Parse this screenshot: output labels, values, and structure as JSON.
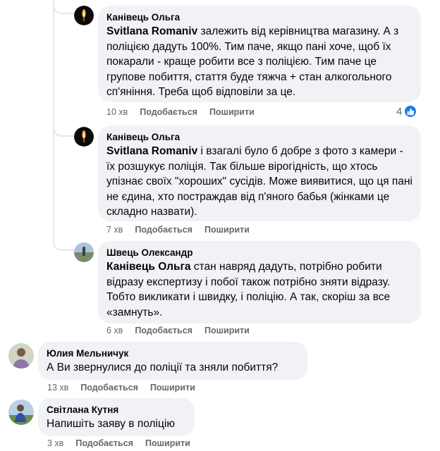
{
  "comments": [
    {
      "author": "Канівець Ольга",
      "mention": "Svitlana Romaniv",
      "text": " залежить від керівництва магазину. А з поліцією дадуть 100%. Тим паче, якщо пані хоче, щоб їх покарали - краще робити все з поліцією. Тим паче це групове побиття, стаття буде тяжча + стан алкогольного сп'яніння. Треба щоб відповіли за це.",
      "time": "10 хв",
      "like_label": "Подобається",
      "share_label": "Поширити",
      "reaction_count": "4",
      "reaction_icon": "like-icon"
    },
    {
      "author": "Канівець Ольга",
      "mention": "Svitlana Romaniv",
      "text": " і взагалі було б добре з фото з камери - їх розшукує поліція. Так більше вірогідність, що хтось упізнає своїх \"хороших\" сусідів. Може виявитися, що ця пані не єдина, хто постраждав від п'яного бабья (жінками це складно назвати).",
      "time": "7 хв",
      "like_label": "Подобається",
      "share_label": "Поширити"
    },
    {
      "author": "Швець Олександр",
      "mention": "Канівець Ольга",
      "text": " стан навряд дадуть, потрібно робити відразу експертизу і побої також потрібно зняти відразу. Тобто викликати і швидку, і поліцію. А так, скоріш за все «замнуть».",
      "time": "6 хв",
      "like_label": "Подобається",
      "share_label": "Поширити"
    },
    {
      "author": "Юлия Мельничук",
      "text": "А Ви звернулися до поліції та зняли побиття?",
      "time": "13 хв",
      "like_label": "Подобається",
      "share_label": "Поширити"
    },
    {
      "author": "Світлана Кутня",
      "text": "Напишіть заяву в поліцію",
      "time": "3 хв",
      "like_label": "Подобається",
      "share_label": "Поширити"
    }
  ],
  "colors": {
    "bubble": "#f0f2f5",
    "meta": "#65676b",
    "like_blue": "#1877f2"
  }
}
